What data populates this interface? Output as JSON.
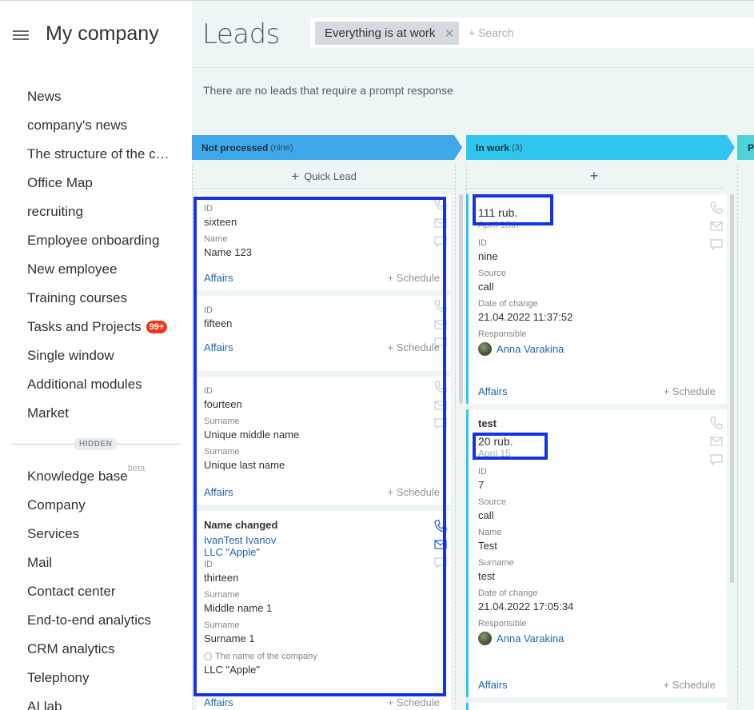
{
  "sidebar": {
    "title": "My company",
    "items": [
      {
        "label": "News"
      },
      {
        "label": "company's news"
      },
      {
        "label": "The structure of the co..."
      },
      {
        "label": "Office Map"
      },
      {
        "label": "recruiting"
      },
      {
        "label": "Employee onboarding"
      },
      {
        "label": "New employee"
      },
      {
        "label": "Training courses"
      },
      {
        "label": "Tasks and Projects",
        "badge": "99+"
      },
      {
        "label": "Single window"
      },
      {
        "label": "Additional modules"
      },
      {
        "label": "Market"
      }
    ],
    "hidden_label": "HIDDEN",
    "hidden_items": [
      {
        "label": "Knowledge base",
        "sup": "beta"
      },
      {
        "label": "Company"
      },
      {
        "label": "Services"
      },
      {
        "label": "Mail"
      },
      {
        "label": "Contact center"
      },
      {
        "label": "End-to-end analytics"
      },
      {
        "label": "CRM analytics"
      },
      {
        "label": "Telephony"
      },
      {
        "label": "AI lab"
      }
    ]
  },
  "header": {
    "title": "Leads",
    "filter_chip": "Everything is at work",
    "search_placeholder": "+ Search"
  },
  "notice": "There are no leads that require a prompt response",
  "columns": [
    {
      "name": "Not processed",
      "count": "(nine)",
      "color": "#3fa8e8",
      "quick": "Quick Lead"
    },
    {
      "name": "In work",
      "count": "(3)",
      "color": "#2fc5ee",
      "quick": "+"
    },
    {
      "name": "P",
      "color": "#4fd3d8"
    }
  ],
  "common": {
    "affairs": "Affairs",
    "schedule": "+ Schedule"
  },
  "col1_cards": [
    {
      "fields": [
        {
          "label": "ID",
          "value": "sixteen"
        },
        {
          "label": "Name",
          "value": "Name 123"
        }
      ]
    },
    {
      "fields": [
        {
          "label": "ID",
          "value": "fifteen"
        }
      ]
    },
    {
      "fields": [
        {
          "label": "ID",
          "value": "fourteen"
        },
        {
          "label": "Surname",
          "value": "Unique middle name"
        },
        {
          "label": "Surname",
          "value": "Unique last name"
        }
      ]
    },
    {
      "title": "Name changed",
      "contact": "IvanTest Ivanov",
      "company": "LLC \"Apple\"",
      "fields": [
        {
          "label": "ID",
          "value": "thirteen"
        },
        {
          "label": "Surname",
          "value": "Middle name 1"
        },
        {
          "label": "Surname",
          "value": "Surname 1"
        }
      ],
      "company_label": "The name of the company",
      "company_value": "LLC \"Apple\""
    }
  ],
  "col2_cards": [
    {
      "price": "111 rub.",
      "date": "April 18th",
      "fields": [
        {
          "label": "ID",
          "value": "nine"
        },
        {
          "label": "Source",
          "value": "call"
        },
        {
          "label": "Date of change",
          "value": "21.04.2022 11:37:52"
        }
      ],
      "responsible_label": "Responsible",
      "responsible": "Anna Varakina"
    },
    {
      "title": "test",
      "price": "20 rub.",
      "date": "April 15",
      "fields": [
        {
          "label": "ID",
          "value": "7"
        },
        {
          "label": "Source",
          "value": "call"
        },
        {
          "label": "Name",
          "value": "Test"
        },
        {
          "label": "Surname",
          "value": "test"
        },
        {
          "label": "Date of change",
          "value": "21.04.2022 17:05:34"
        }
      ],
      "responsible_label": "Responsible",
      "responsible": "Anna Varakina"
    }
  ],
  "colors": {
    "highlight": "#1433e5",
    "link": "#2067b0",
    "badge": "#f1361b"
  }
}
